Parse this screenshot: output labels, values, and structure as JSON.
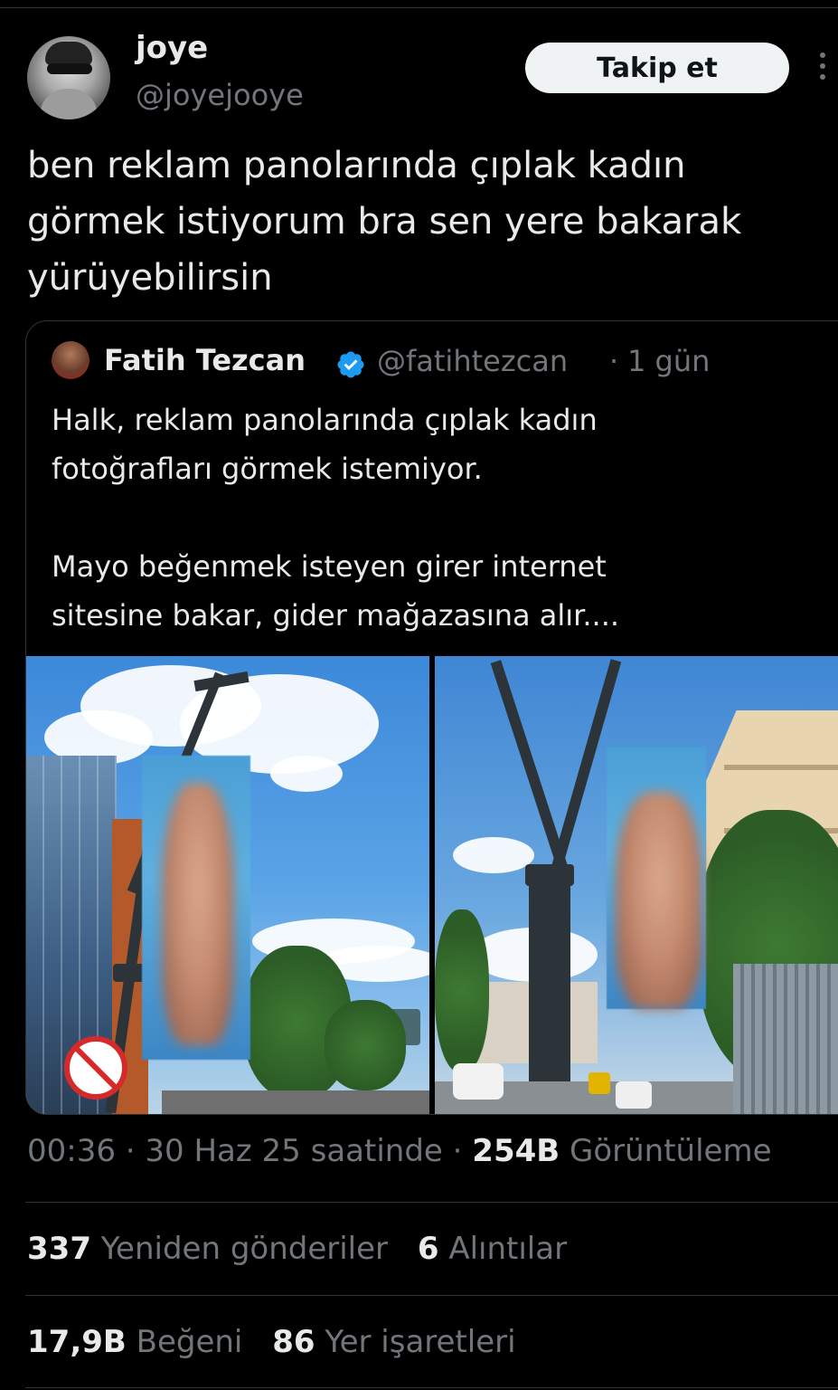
{
  "author": {
    "name": "joye",
    "handle": "@joyejooye",
    "follow_label": "Takip et"
  },
  "tweet": {
    "text": "ben reklam panolarında çıplak kadın\ngörmek istiyorum bra sen yere bakarak\nyürüyebilirsin"
  },
  "quoted": {
    "name": "Fatih Tezcan",
    "handle": "@fatihtezcan",
    "separator": "·",
    "time": "1 gün",
    "text_line1": "Halk, reklam panolarında çıplak kadın",
    "text_line2": "fotoğrafları görmek istemiyor.",
    "text_line3": "Mayo beğenmek isteyen girer internet",
    "text_line4": "sitesine bakar, gider mağazasına alır....",
    "verified_color": "#1d9bf0"
  },
  "meta": {
    "time": "00:36",
    "sep1": "·",
    "date": "30 Haz 25 saatinde",
    "sep2": "·",
    "views_count": "254B",
    "views_label": "Görüntüleme"
  },
  "stats": {
    "retweets_count": "337",
    "retweets_label": "Yeniden gönderiler",
    "quotes_count": "6",
    "quotes_label": "Alıntılar",
    "likes_count": "17,9B",
    "likes_label": "Beğeni",
    "bookmarks_count": "86",
    "bookmarks_label": "Yer işaretleri"
  },
  "colors": {
    "background": "#000000",
    "text": "#e7e9ea",
    "secondary": "#71767b",
    "border": "#2f3336",
    "follow_bg": "#eff3f4"
  }
}
